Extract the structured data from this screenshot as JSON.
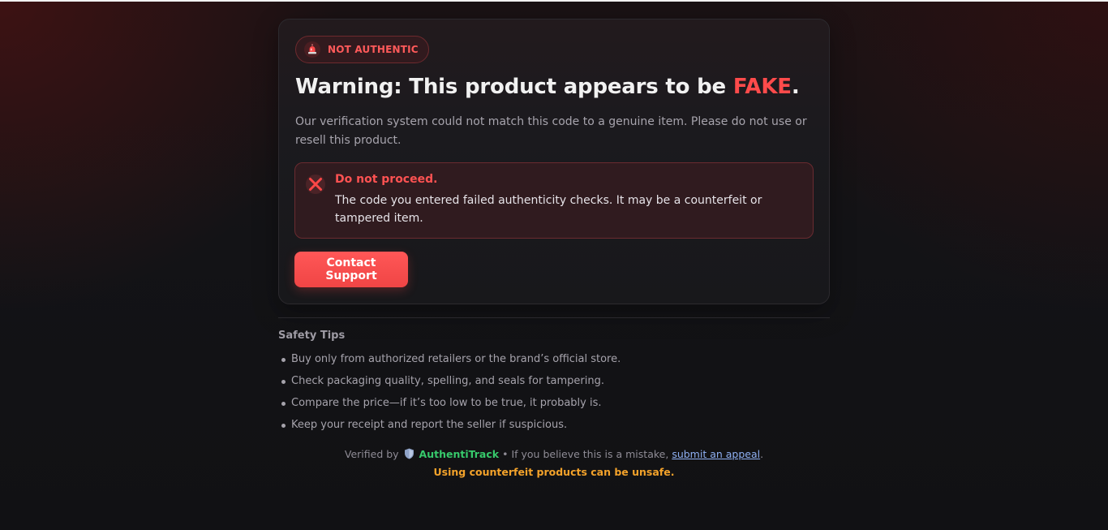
{
  "status_badge": {
    "label": "NOT AUTHENTIC",
    "icon": "siren-icon",
    "color": "#ff5a5a"
  },
  "heading": {
    "prefix": "Warning: This product appears to be ",
    "highlight": "FAKE",
    "suffix": ".",
    "highlight_color": "#ff4b4b"
  },
  "description": "Our verification system could not match this code to a genuine item. Please do not use or resell this product.",
  "alert": {
    "icon": "x-icon",
    "title": "Do not proceed.",
    "body": "The code you entered failed authenticity checks. It may be a counterfeit or tampered item."
  },
  "actions": {
    "contact_support_label": "Contact Support",
    "button_color": "#ff5757"
  },
  "safety_tips": {
    "title": "Safety Tips",
    "items": [
      "Buy only from authorized retailers or the brand’s official store.",
      "Check packaging quality, spelling, and seals for tampering.",
      "Compare the price—if it’s too low to be true, it probably is.",
      "Keep your receipt and report the seller if suspicious."
    ]
  },
  "footer": {
    "verified_by": "Verified by",
    "shield_icon": "shield-icon",
    "brand": "AuthentiTrack",
    "brand_color": "#37c96b",
    "separator": "•",
    "mistake_text": "If you believe this is a mistake,",
    "appeal_link": "submit an appeal",
    "appeal_suffix": ".",
    "warning": "Using counterfeit products can be unsafe.",
    "warning_color": "#f3a22a"
  }
}
